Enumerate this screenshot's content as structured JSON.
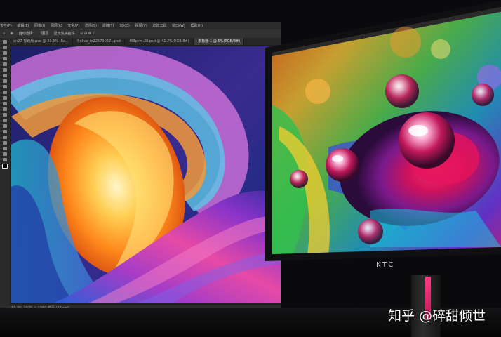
{
  "photoshop": {
    "menu_items": [
      "文件(F)",
      "编辑(E)",
      "图像(I)",
      "图层(L)",
      "文字(Y)",
      "选择(S)",
      "滤镜(T)",
      "3D(D)",
      "视图(V)",
      "增效工具",
      "窗口(W)",
      "帮助(H)"
    ],
    "options": [
      "自动选择：",
      "图层",
      "显示变换控件"
    ],
    "tabs": [
      {
        "label": "en27-标题版.psd @ 39.6% (Rc...",
        "active": false
      },
      {
        "label": "Bolive_fx22579027...psd",
        "active": false
      },
      {
        "label": "f08pcm.20.psd @ 41.2%(RGB/8#)",
        "active": false
      },
      {
        "label": "未标题-1 @ 5%(RGB/8#)",
        "active": true
      }
    ],
    "status_text": "33.3%   1920 × 1080 像素 (72 ppi)"
  },
  "monitor": {
    "brand_logo": "KTC"
  },
  "watermark": {
    "text": "知乎 @碎甜倾世"
  },
  "colors": {
    "stand_accent": "#e91e63",
    "ps_dark": "#1f1f1f"
  }
}
